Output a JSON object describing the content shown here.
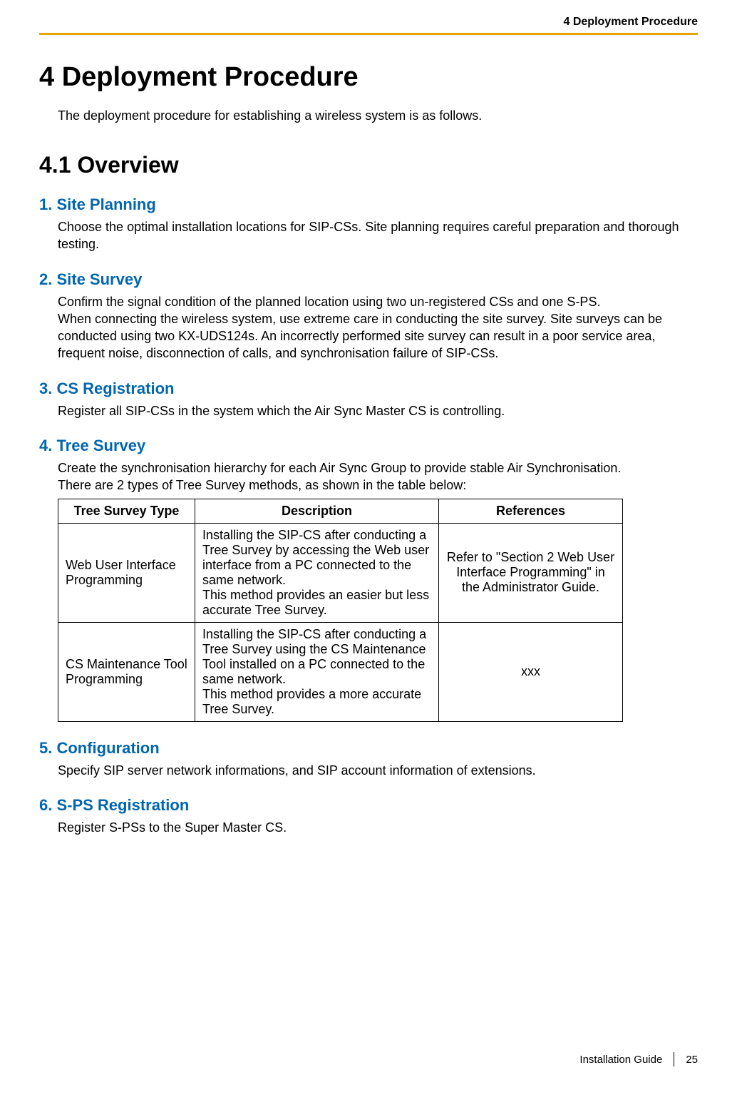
{
  "header": {
    "running_title": "4 Deployment Procedure"
  },
  "chapter": {
    "number_title": "4   Deployment Procedure",
    "intro": "The deployment procedure for establishing a wireless system is as follows."
  },
  "overview": {
    "heading": "4.1  Overview"
  },
  "sections": {
    "site_planning": {
      "heading": "1. Site Planning",
      "body": "Choose the optimal installation locations for SIP-CSs. Site planning requires careful preparation and thorough testing."
    },
    "site_survey": {
      "heading": "2. Site Survey",
      "line1": "Confirm the signal condition of the planned location using two un-registered CSs and one S-PS.",
      "line2": "When connecting the wireless system, use extreme care in conducting the site survey. Site surveys can be conducted using two KX-UDS124s. An incorrectly performed site survey can result in a poor service area, frequent noise, disconnection of calls, and synchronisation failure of SIP-CSs."
    },
    "cs_registration": {
      "heading": "3. CS Registration",
      "body": "Register all SIP-CSs in the system which the Air Sync Master CS is controlling."
    },
    "tree_survey": {
      "heading": "4. Tree Survey",
      "line1": "Create the synchronisation hierarchy for each Air Sync Group to provide stable Air Synchronisation.",
      "line2": "There are 2 types of Tree Survey methods, as shown in the table below:",
      "table": {
        "headers": {
          "type": "Tree Survey Type",
          "desc": "Description",
          "ref": "References"
        },
        "rows": [
          {
            "type": "Web User Interface Programming",
            "desc": "Installing the SIP-CS after conducting a Tree Survey by accessing the Web user interface from a PC connected to the same network.\nThis method provides an easier but less accurate Tree Survey.",
            "ref": "Refer to \"Section 2 Web User Interface Programming\" in the Administrator Guide."
          },
          {
            "type": "CS Maintenance Tool Programming",
            "desc": "Installing the SIP-CS after conducting a Tree Survey using the CS Maintenance Tool installed on a PC connected to the same network.\nThis method provides a more accurate Tree Survey.",
            "ref": "xxx"
          }
        ]
      }
    },
    "configuration": {
      "heading": "5. Configuration",
      "body": "Specify SIP server network informations, and SIP account information of extensions."
    },
    "sps_registration": {
      "heading": "6. S-PS Registration",
      "body": "Register S-PSs to the Super Master CS."
    }
  },
  "footer": {
    "guide": "Installation Guide",
    "page": "25"
  }
}
